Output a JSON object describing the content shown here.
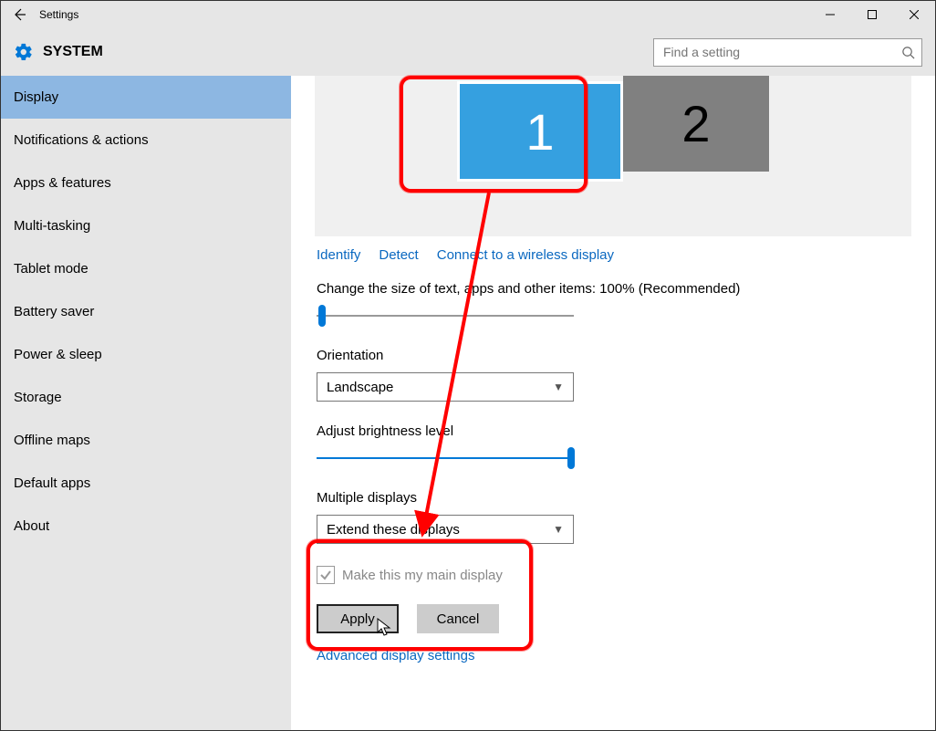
{
  "window": {
    "title": "Settings"
  },
  "header": {
    "system_label": "SYSTEM"
  },
  "search": {
    "placeholder": "Find a setting"
  },
  "sidebar": {
    "items": [
      {
        "label": "Display"
      },
      {
        "label": "Notifications & actions"
      },
      {
        "label": "Apps & features"
      },
      {
        "label": "Multi-tasking"
      },
      {
        "label": "Tablet mode"
      },
      {
        "label": "Battery saver"
      },
      {
        "label": "Power & sleep"
      },
      {
        "label": "Storage"
      },
      {
        "label": "Offline maps"
      },
      {
        "label": "Default apps"
      },
      {
        "label": "About"
      }
    ]
  },
  "display": {
    "monitor1": "1",
    "monitor2": "2",
    "links": {
      "identify": "Identify",
      "detect": "Detect",
      "wireless": "Connect to a wireless display"
    },
    "scale_label": "Change the size of text, apps and other items: 100% (Recommended)",
    "orientation_label": "Orientation",
    "orientation_value": "Landscape",
    "brightness_label": "Adjust brightness level",
    "multiple_label": "Multiple displays",
    "multiple_value": "Extend these displays",
    "main_display_check": "Make this my main display",
    "apply": "Apply",
    "cancel": "Cancel",
    "advanced": "Advanced display settings"
  }
}
